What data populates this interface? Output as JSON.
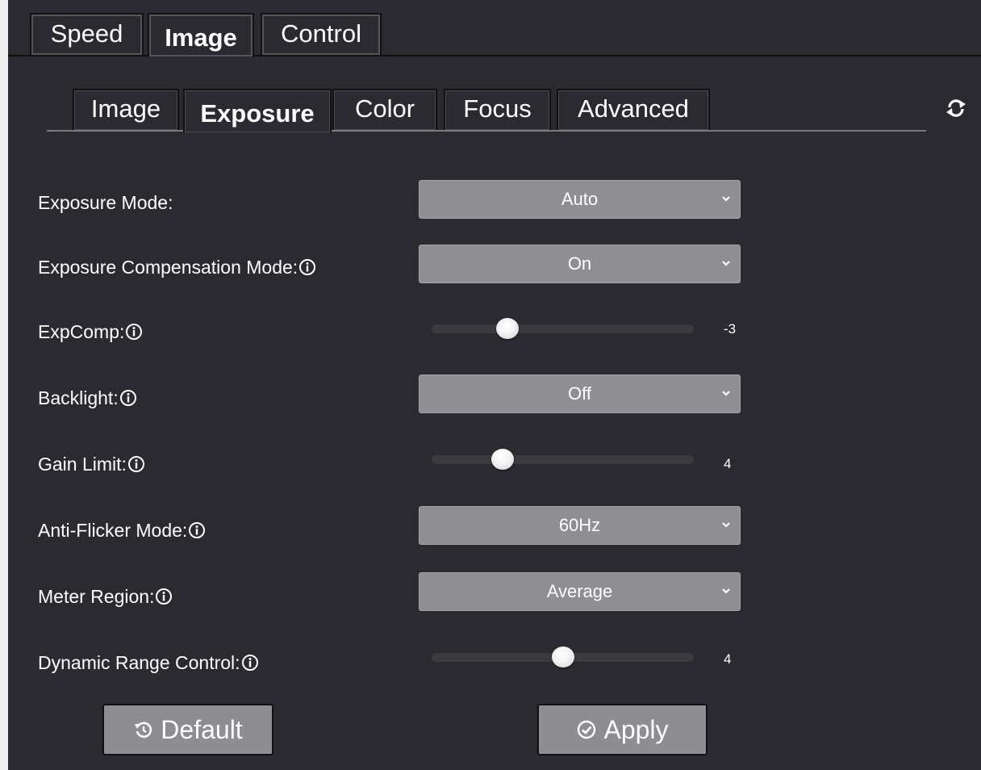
{
  "top_tabs": [
    {
      "label": "Speed",
      "active": false
    },
    {
      "label": "Image",
      "active": true
    },
    {
      "label": "Control",
      "active": false
    }
  ],
  "sub_tabs": [
    {
      "label": "Image",
      "active": false
    },
    {
      "label": "Exposure",
      "active": true
    },
    {
      "label": "Color",
      "active": false
    },
    {
      "label": "Focus",
      "active": false
    },
    {
      "label": "Advanced",
      "active": false
    }
  ],
  "icons": {
    "refresh": "refresh-icon",
    "info": "info-icon",
    "chevron": "chevron-down-icon",
    "default": "restore-icon",
    "apply": "check-circle-icon"
  },
  "settings": {
    "exposure_mode": {
      "label": "Exposure Mode:",
      "value": "Auto"
    },
    "exposure_compensation_mode": {
      "label": "Exposure Compensation Mode:",
      "value": "On"
    },
    "expcomp": {
      "label": "ExpComp:",
      "value": "-3",
      "level": 0.29
    },
    "backlight": {
      "label": "Backlight:",
      "value": "Off"
    },
    "gain_limit": {
      "label": "Gain Limit:",
      "value": "4",
      "level": 0.27
    },
    "anti_flicker_mode": {
      "label": "Anti-Flicker Mode:",
      "value": "60Hz"
    },
    "meter_region": {
      "label": "Meter Region:",
      "value": "Average"
    },
    "dynamic_range_control": {
      "label": "Dynamic Range Control:",
      "value": "4",
      "level": 0.5
    }
  },
  "buttons": {
    "default_label": "Default",
    "apply_label": "Apply"
  },
  "colors": {
    "panel_background": "#2b2a30",
    "control_background": "#8f8e93",
    "text": "#ffffff"
  }
}
